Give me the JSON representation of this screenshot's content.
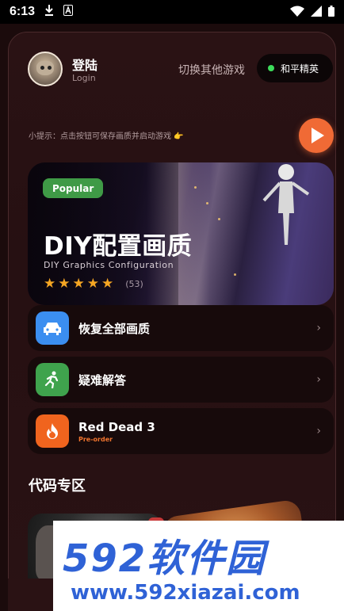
{
  "status_bar": {
    "time": "6:13"
  },
  "header": {
    "login_title": "登陆",
    "login_sub": "Login",
    "switch_text": "切换其他游戏",
    "game_pill": "和平精英"
  },
  "tip": "小提示：点击按钮可保存画质并启动游戏 👉",
  "banner": {
    "badge": "Popular",
    "title": "DIY配置画质",
    "subtitle": "DIY Graphics Configuration",
    "stars": 5,
    "rating_count": "(53)"
  },
  "list": [
    {
      "label": "恢复全部画质",
      "icon": "car-icon",
      "color": "#3b8ef0"
    },
    {
      "label": "疑难解答",
      "icon": "runner-icon",
      "color": "#3fa34d"
    },
    {
      "label": "Red Dead 3",
      "sub": "Pre-order",
      "icon": "fire-icon",
      "color": "#f0641e"
    }
  ],
  "section_title": "代码专区",
  "watermark": {
    "logo": "592软件园",
    "url": "www.592xiazai.com"
  },
  "colors": {
    "accent": "#f06a35",
    "popular": "#3f9a46",
    "background": "#1b0b0c"
  }
}
